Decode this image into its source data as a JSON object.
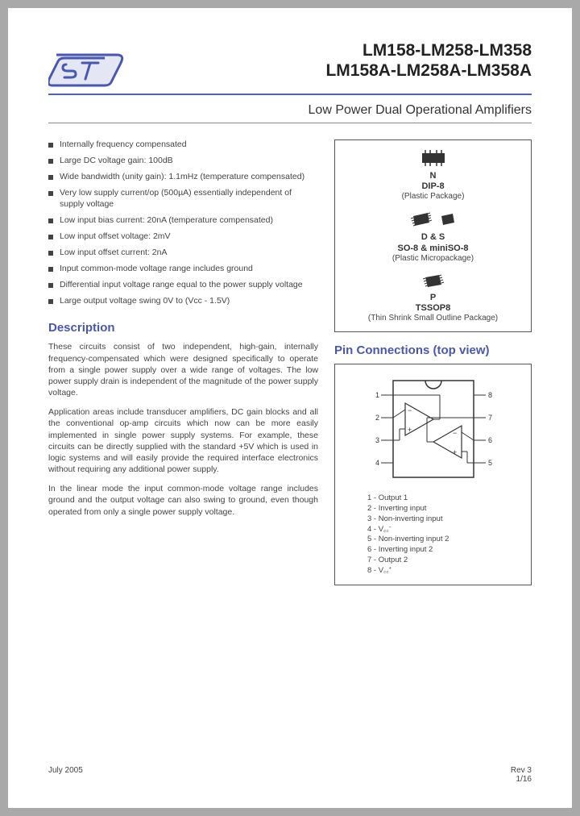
{
  "header": {
    "title_line1": "LM158-LM258-LM358",
    "title_line2": "LM158A-LM258A-LM358A",
    "subtitle": "Low Power Dual Operational Amplifiers"
  },
  "features": [
    "Internally frequency compensated",
    "Large DC voltage gain: 100dB",
    "Wide bandwidth (unity gain): 1.1mHz (temperature compensated)",
    "Very low supply current/op (500µA) essentially independent of supply voltage",
    "Low input bias current: 20nA (temperature compensated)",
    "Low input offset voltage: 2mV",
    "Low input offset current: 2nA",
    "Input common-mode voltage range includes ground",
    "Differential input voltage range equal to the power supply voltage",
    "Large output voltage swing 0V to (Vcc - 1.5V)"
  ],
  "description": {
    "heading": "Description",
    "paragraphs": [
      "These circuits consist of two independent, high-gain, internally frequency-compensated which were designed specifically to operate from a single power supply over a wide range of voltages. The low power supply drain is independent of the magnitude of the power supply voltage.",
      "Application areas include transducer amplifiers, DC gain blocks and all the conventional op-amp circuits which now can be more easily implemented in single power supply systems. For example, these circuits can be directly supplied with the standard +5V which is used in logic systems and will easily provide the required interface electronics without requiring any additional power supply.",
      "In the linear mode the input common-mode voltage range includes ground and the output voltage can also swing to ground, even though operated from only a single power supply voltage."
    ]
  },
  "packages": [
    {
      "code": "N",
      "name": "DIP-8",
      "note": "(Plastic Package)"
    },
    {
      "code": "D & S",
      "name": "SO-8 & miniSO-8",
      "note": "(Plastic Micropackage)"
    },
    {
      "code": "P",
      "name": "TSSOP8",
      "note": "(Thin Shrink Small Outline Package)"
    }
  ],
  "pin_connections": {
    "heading": "Pin Connections (top view)",
    "pins": [
      "1 - Output 1",
      "2 - Inverting input",
      "3 - Non-inverting input",
      "4 - V꜀꜀⁻",
      "5 - Non-inverting input 2",
      "6 - Inverting input 2",
      "7 - Output 2",
      "8 - V꜀꜀⁺"
    ]
  },
  "footer": {
    "date": "July 2005",
    "rev": "Rev 3",
    "page": "1/16"
  }
}
